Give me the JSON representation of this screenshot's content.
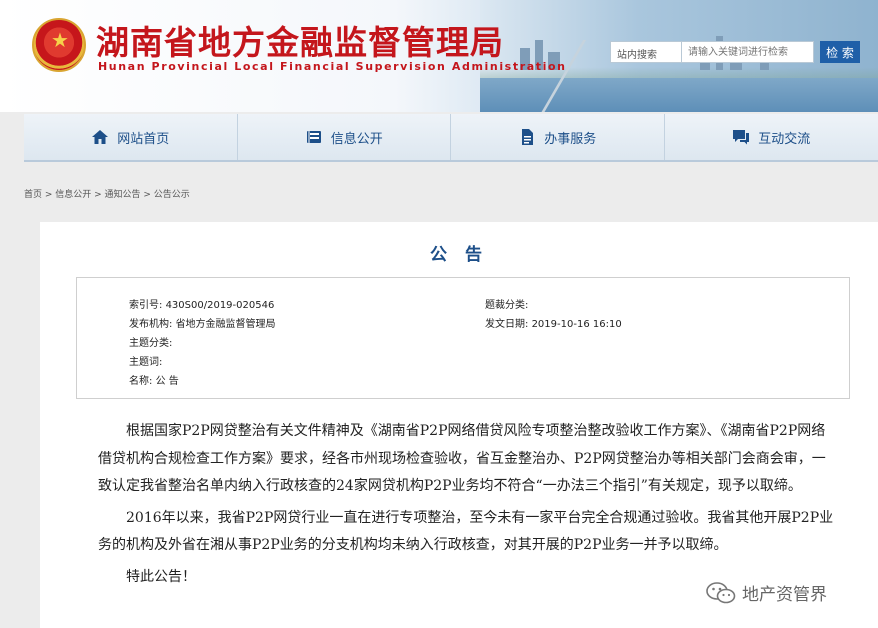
{
  "header": {
    "title": "湖南省地方金融监督管理局",
    "subtitle": "Hunan Provincial Local Financial Supervision Administration",
    "search": {
      "scope": "站内搜索",
      "placeholder": "请输入关键词进行检索",
      "button": "检 索"
    }
  },
  "nav": {
    "items": [
      {
        "label": "网站首页",
        "icon": "home-icon"
      },
      {
        "label": "信息公开",
        "icon": "book-icon"
      },
      {
        "label": "办事服务",
        "icon": "document-icon"
      },
      {
        "label": "互动交流",
        "icon": "chat-icon"
      }
    ]
  },
  "breadcrumb": "首页 > 信息公开 > 通知公告 > 公告公示",
  "article": {
    "title": "公 告",
    "meta": {
      "index_label": "索引号:",
      "index_value": "430S00/2019-020546",
      "category_label": "题裁分类:",
      "category_value": "",
      "publisher_label": "发布机构:",
      "publisher_value": "省地方金融监督管理局",
      "date_label": "发文日期:",
      "date_value": "2019-10-16 16:10",
      "topic_label": "主题分类:",
      "topic_value": "",
      "keyword_label": "主题词:",
      "keyword_value": "",
      "name_label": "名称:",
      "name_value": "公 告"
    },
    "paragraphs": [
      "根据国家P2P网贷整治有关文件精神及《湖南省P2P网络借贷风险专项整治整改验收工作方案》、《湖南省P2P网络借贷机构合规检查工作方案》要求，经各市州现场检查验收，省互金整治办、P2P网贷整治办等相关部门会商会审，一致认定我省整治名单内纳入行政核查的24家网贷机构P2P业务均不符合“一办法三个指引”有关规定，现予以取缔。",
      "2016年以来，我省P2P网贷行业一直在进行专项整治，至今未有一家平台完全合规通过验收。我省其他开展P2P业务的机构及外省在湘从事P2P业务的分支机构均未纳入行政核查，对其开展的P2P业务一并予以取缔。",
      "特此公告！"
    ]
  },
  "watermark": "地产资管界"
}
